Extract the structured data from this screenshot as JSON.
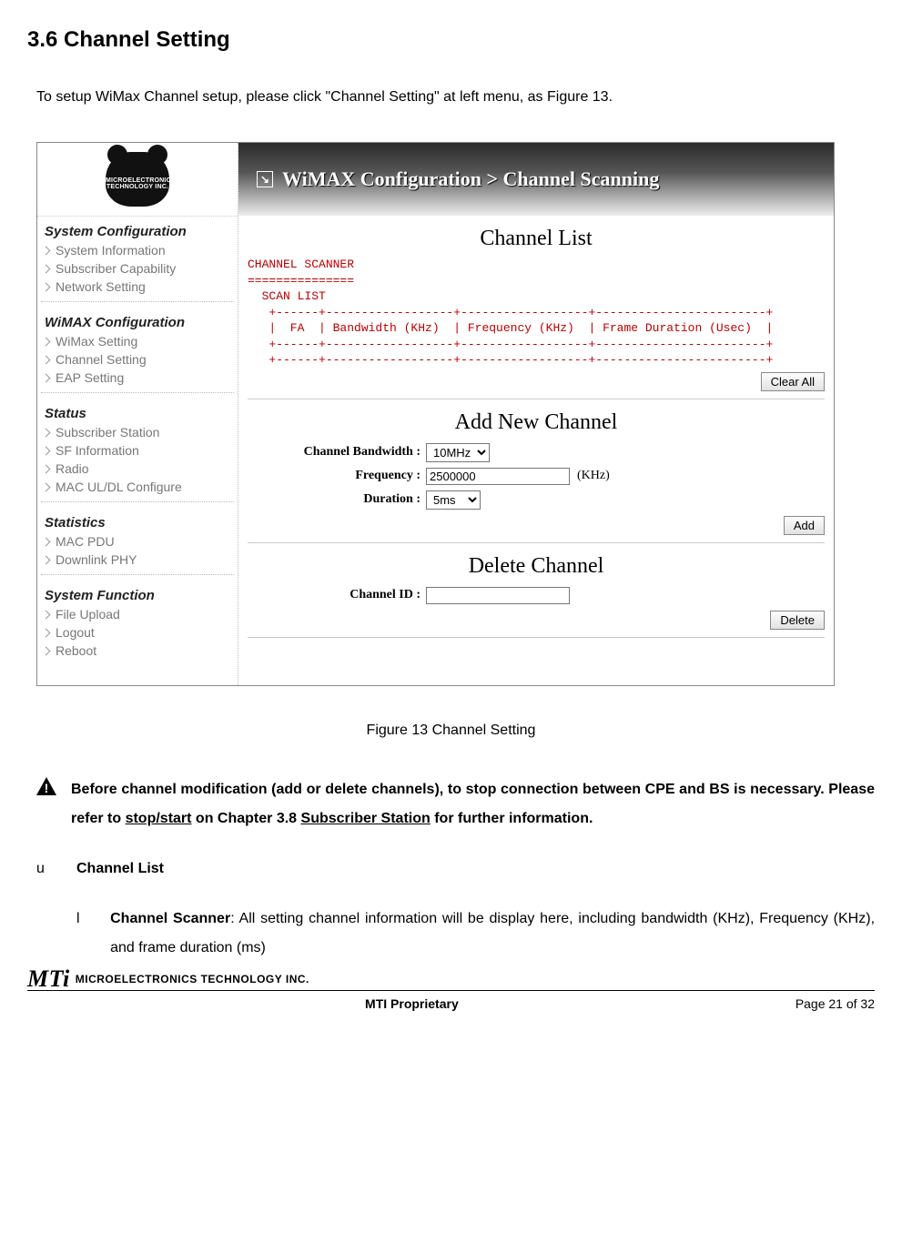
{
  "heading": "3.6    Channel Setting",
  "intro": "To setup WiMax Channel setup, please click \"Channel Setting\" at left menu, as Figure 13.",
  "screenshot": {
    "logo_text": "MICROELECTRONICS TECHNOLOGY INC.",
    "sidebar": {
      "sections": [
        {
          "title": "System Configuration",
          "items": [
            "System Information",
            "Subscriber Capability",
            "Network Setting"
          ]
        },
        {
          "title": "WiMAX Configuration",
          "items": [
            "WiMax Setting",
            "Channel Setting",
            "EAP Setting"
          ]
        },
        {
          "title": "Status",
          "items": [
            "Subscriber Station",
            "SF Information",
            "Radio",
            "MAC UL/DL Configure"
          ]
        },
        {
          "title": "Statistics",
          "items": [
            "MAC PDU",
            "Downlink PHY"
          ]
        },
        {
          "title": "System Function",
          "items": [
            "File Upload",
            "Logout",
            "Reboot"
          ]
        }
      ]
    },
    "banner": "WiMAX Configuration > Channel Scanning",
    "channel_list": {
      "title": "Channel List",
      "mono": "CHANNEL SCANNER\n===============\n  SCAN LIST\n   +------+------------------+------------------+------------------------+\n   |  FA  | Bandwidth (KHz)  | Frequency (KHz)  | Frame Duration (Usec)  |\n   +------+------------------+------------------+------------------------+\n   +------+------------------+------------------+------------------------+",
      "clear_btn": "Clear All"
    },
    "add_channel": {
      "title": "Add New Channel",
      "bw_label": "Channel Bandwidth :",
      "bw_value": "10MHz",
      "freq_label": "Frequency :",
      "freq_value": "2500000",
      "freq_unit": "(KHz)",
      "dur_label": "Duration :",
      "dur_value": "5ms",
      "add_btn": "Add"
    },
    "delete_channel": {
      "title": "Delete Channel",
      "id_label": "Channel ID :",
      "id_value": "",
      "del_btn": "Delete"
    }
  },
  "figure_caption": "Figure 13    Channel Setting",
  "warning": {
    "pre": "Before channel modification (add or delete channels), to stop connection between CPE and BS is necessary. Please refer to ",
    "link1": "stop/start",
    "mid": " on Chapter 3.8 ",
    "link2": "Subscriber Station",
    "post": " for further information."
  },
  "bullet_u": {
    "mark": "u",
    "text": "Channel List"
  },
  "bullet_l": {
    "mark": "l",
    "bold": "Channel Scanner",
    "rest": ": All setting channel information will be display here, including bandwidth (KHz), Frequency (KHz), and frame duration (ms)"
  },
  "footer": {
    "logo_big": "MTi",
    "logo_small": "MICROELECTRONICS TECHNOLOGY INC.",
    "center": "MTI Proprietary",
    "right": "Page 21 of 32"
  }
}
